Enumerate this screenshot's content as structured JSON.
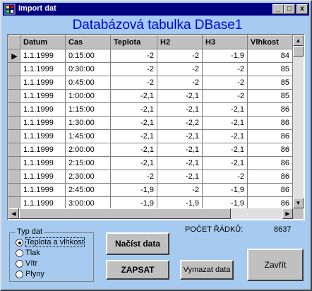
{
  "window": {
    "title": "Import dat",
    "min": "_",
    "max": "□",
    "close": "x"
  },
  "heading": "Databázová tabulka DBase1",
  "table": {
    "columns": [
      "Datum",
      "Cas",
      "Teplota",
      "H2",
      "H3",
      "Vlhkost"
    ],
    "rows": [
      [
        "1.1.1999",
        "0:15:00",
        "-2",
        "-2",
        "-1,9",
        "84"
      ],
      [
        "1.1.1999",
        "0:30:00",
        "-2",
        "-2",
        "-2",
        "85"
      ],
      [
        "1.1.1999",
        "0:45:00",
        "-2",
        "-2",
        "-2",
        "85"
      ],
      [
        "1.1.1999",
        "1:00:00",
        "-2,1",
        "-2,1",
        "-2",
        "85"
      ],
      [
        "1.1.1999",
        "1:15:00",
        "-2,1",
        "-2,1",
        "-2,1",
        "86"
      ],
      [
        "1.1.1999",
        "1:30:00",
        "-2,1",
        "-2,2",
        "-2,1",
        "86"
      ],
      [
        "1.1.1999",
        "1:45:00",
        "-2,1",
        "-2,1",
        "-2,1",
        "86"
      ],
      [
        "1.1.1999",
        "2:00:00",
        "-2,1",
        "-2,1",
        "-2,1",
        "86"
      ],
      [
        "1.1.1999",
        "2:15:00",
        "-2,1",
        "-2,1",
        "-2,1",
        "86"
      ],
      [
        "1.1.1999",
        "2:30:00",
        "-2",
        "-2,1",
        "-2",
        "86"
      ],
      [
        "1.1.1999",
        "2:45:00",
        "-1,9",
        "-2",
        "-1,9",
        "86"
      ],
      [
        "1.1.1999",
        "3:00:00",
        "-1,9",
        "-1,9",
        "-1,9",
        "86"
      ]
    ]
  },
  "status": {
    "label": "POČET ŘÁDKŮ:",
    "value": "8637"
  },
  "group": {
    "legend": "Typ dat",
    "options": [
      {
        "label": "Teplota a vlhkost",
        "selected": true
      },
      {
        "label": "Tlak",
        "selected": false
      },
      {
        "label": "Vítr",
        "selected": false
      },
      {
        "label": "Plyny",
        "selected": false
      }
    ]
  },
  "buttons": {
    "load": "Načíst data",
    "write": "ZAPSAT",
    "clear": "Vymazat data",
    "close": "Zavřít"
  },
  "colors": {
    "background": "#a6caf0",
    "titlebar": "#000080",
    "heading": "#0000e0"
  }
}
